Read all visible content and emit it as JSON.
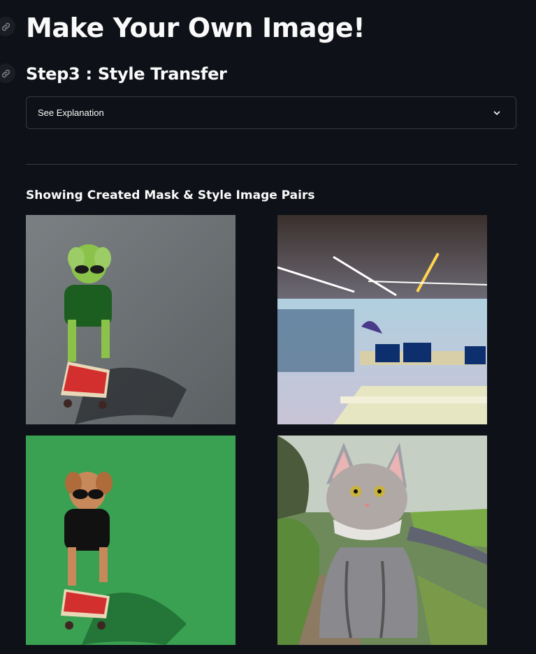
{
  "page": {
    "title": "Make Your Own Image!",
    "step_heading": "Step3 : Style Transfer",
    "expander": {
      "label": "See Explanation",
      "icon": "chevron-down-icon"
    },
    "section_heading": "Showing Created Mask & Style Image Pairs"
  },
  "images": [
    {
      "name": "mask-image-1",
      "description_icon": "image"
    },
    {
      "name": "style-image-1",
      "description_icon": "image"
    },
    {
      "name": "mask-image-2",
      "description_icon": "image"
    },
    {
      "name": "style-image-2",
      "description_icon": "image"
    }
  ],
  "colors": {
    "background": "#0e1117",
    "text": "#fafafa",
    "border": "#363945"
  }
}
